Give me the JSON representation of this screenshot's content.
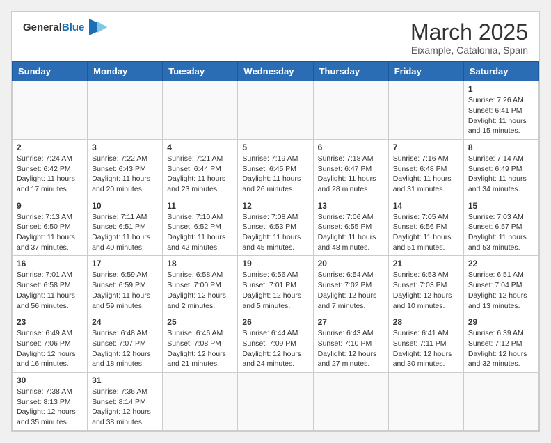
{
  "header": {
    "logo_general": "General",
    "logo_blue": "Blue",
    "month_title": "March 2025",
    "location": "Eixample, Catalonia, Spain"
  },
  "columns": [
    "Sunday",
    "Monday",
    "Tuesday",
    "Wednesday",
    "Thursday",
    "Friday",
    "Saturday"
  ],
  "weeks": [
    [
      {
        "day": "",
        "info": ""
      },
      {
        "day": "",
        "info": ""
      },
      {
        "day": "",
        "info": ""
      },
      {
        "day": "",
        "info": ""
      },
      {
        "day": "",
        "info": ""
      },
      {
        "day": "",
        "info": ""
      },
      {
        "day": "1",
        "info": "Sunrise: 7:26 AM\nSunset: 6:41 PM\nDaylight: 11 hours\nand 15 minutes."
      }
    ],
    [
      {
        "day": "2",
        "info": "Sunrise: 7:24 AM\nSunset: 6:42 PM\nDaylight: 11 hours\nand 17 minutes."
      },
      {
        "day": "3",
        "info": "Sunrise: 7:22 AM\nSunset: 6:43 PM\nDaylight: 11 hours\nand 20 minutes."
      },
      {
        "day": "4",
        "info": "Sunrise: 7:21 AM\nSunset: 6:44 PM\nDaylight: 11 hours\nand 23 minutes."
      },
      {
        "day": "5",
        "info": "Sunrise: 7:19 AM\nSunset: 6:45 PM\nDaylight: 11 hours\nand 26 minutes."
      },
      {
        "day": "6",
        "info": "Sunrise: 7:18 AM\nSunset: 6:47 PM\nDaylight: 11 hours\nand 28 minutes."
      },
      {
        "day": "7",
        "info": "Sunrise: 7:16 AM\nSunset: 6:48 PM\nDaylight: 11 hours\nand 31 minutes."
      },
      {
        "day": "8",
        "info": "Sunrise: 7:14 AM\nSunset: 6:49 PM\nDaylight: 11 hours\nand 34 minutes."
      }
    ],
    [
      {
        "day": "9",
        "info": "Sunrise: 7:13 AM\nSunset: 6:50 PM\nDaylight: 11 hours\nand 37 minutes."
      },
      {
        "day": "10",
        "info": "Sunrise: 7:11 AM\nSunset: 6:51 PM\nDaylight: 11 hours\nand 40 minutes."
      },
      {
        "day": "11",
        "info": "Sunrise: 7:10 AM\nSunset: 6:52 PM\nDaylight: 11 hours\nand 42 minutes."
      },
      {
        "day": "12",
        "info": "Sunrise: 7:08 AM\nSunset: 6:53 PM\nDaylight: 11 hours\nand 45 minutes."
      },
      {
        "day": "13",
        "info": "Sunrise: 7:06 AM\nSunset: 6:55 PM\nDaylight: 11 hours\nand 48 minutes."
      },
      {
        "day": "14",
        "info": "Sunrise: 7:05 AM\nSunset: 6:56 PM\nDaylight: 11 hours\nand 51 minutes."
      },
      {
        "day": "15",
        "info": "Sunrise: 7:03 AM\nSunset: 6:57 PM\nDaylight: 11 hours\nand 53 minutes."
      }
    ],
    [
      {
        "day": "16",
        "info": "Sunrise: 7:01 AM\nSunset: 6:58 PM\nDaylight: 11 hours\nand 56 minutes."
      },
      {
        "day": "17",
        "info": "Sunrise: 6:59 AM\nSunset: 6:59 PM\nDaylight: 11 hours\nand 59 minutes."
      },
      {
        "day": "18",
        "info": "Sunrise: 6:58 AM\nSunset: 7:00 PM\nDaylight: 12 hours\nand 2 minutes."
      },
      {
        "day": "19",
        "info": "Sunrise: 6:56 AM\nSunset: 7:01 PM\nDaylight: 12 hours\nand 5 minutes."
      },
      {
        "day": "20",
        "info": "Sunrise: 6:54 AM\nSunset: 7:02 PM\nDaylight: 12 hours\nand 7 minutes."
      },
      {
        "day": "21",
        "info": "Sunrise: 6:53 AM\nSunset: 7:03 PM\nDaylight: 12 hours\nand 10 minutes."
      },
      {
        "day": "22",
        "info": "Sunrise: 6:51 AM\nSunset: 7:04 PM\nDaylight: 12 hours\nand 13 minutes."
      }
    ],
    [
      {
        "day": "23",
        "info": "Sunrise: 6:49 AM\nSunset: 7:06 PM\nDaylight: 12 hours\nand 16 minutes."
      },
      {
        "day": "24",
        "info": "Sunrise: 6:48 AM\nSunset: 7:07 PM\nDaylight: 12 hours\nand 18 minutes."
      },
      {
        "day": "25",
        "info": "Sunrise: 6:46 AM\nSunset: 7:08 PM\nDaylight: 12 hours\nand 21 minutes."
      },
      {
        "day": "26",
        "info": "Sunrise: 6:44 AM\nSunset: 7:09 PM\nDaylight: 12 hours\nand 24 minutes."
      },
      {
        "day": "27",
        "info": "Sunrise: 6:43 AM\nSunset: 7:10 PM\nDaylight: 12 hours\nand 27 minutes."
      },
      {
        "day": "28",
        "info": "Sunrise: 6:41 AM\nSunset: 7:11 PM\nDaylight: 12 hours\nand 30 minutes."
      },
      {
        "day": "29",
        "info": "Sunrise: 6:39 AM\nSunset: 7:12 PM\nDaylight: 12 hours\nand 32 minutes."
      }
    ],
    [
      {
        "day": "30",
        "info": "Sunrise: 7:38 AM\nSunset: 8:13 PM\nDaylight: 12 hours\nand 35 minutes."
      },
      {
        "day": "31",
        "info": "Sunrise: 7:36 AM\nSunset: 8:14 PM\nDaylight: 12 hours\nand 38 minutes."
      },
      {
        "day": "",
        "info": ""
      },
      {
        "day": "",
        "info": ""
      },
      {
        "day": "",
        "info": ""
      },
      {
        "day": "",
        "info": ""
      },
      {
        "day": "",
        "info": ""
      }
    ]
  ]
}
